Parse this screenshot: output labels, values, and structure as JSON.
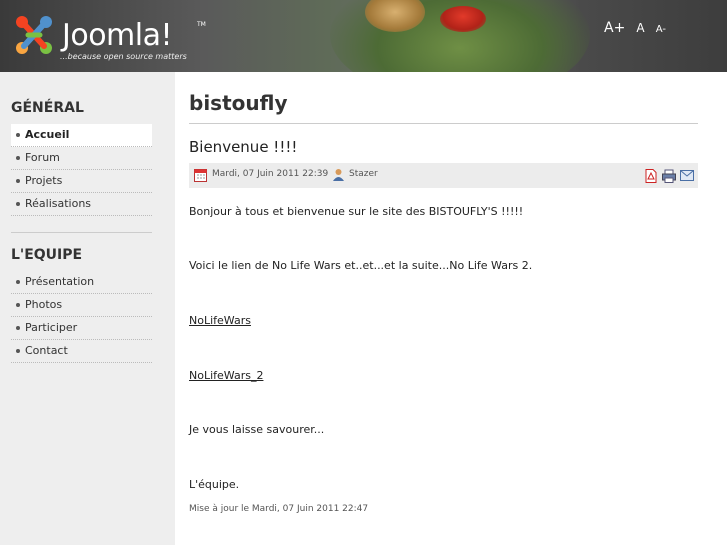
{
  "header": {
    "logo_text": "Joomla!",
    "logo_tm": "TM",
    "tagline": "...because open source matters",
    "font_size_controls": {
      "bigger": "A+",
      "reset": "A",
      "smaller": "A-"
    }
  },
  "sidebar": {
    "modules": [
      {
        "title": "GÉNÉRAL",
        "items": [
          {
            "label": "Accueil",
            "active": true
          },
          {
            "label": "Forum"
          },
          {
            "label": "Projets"
          },
          {
            "label": "Réalisations"
          }
        ]
      },
      {
        "title": "L'EQUIPE",
        "items": [
          {
            "label": "Présentation"
          },
          {
            "label": "Photos"
          },
          {
            "label": "Participer"
          },
          {
            "label": "Contact"
          }
        ]
      }
    ]
  },
  "main": {
    "site_title": "bistoufly",
    "article": {
      "title": "Bienvenue !!!!",
      "date": "Mardi, 07 Juin 2011 22:39",
      "author": "Stazer",
      "paragraphs": [
        "Bonjour à tous et bienvenue sur le site des BISTOUFLY'S !!!!!",
        "Voici le lien de No Life Wars et..et...et la suite...No Life Wars 2.",
        "Je vous laisse savourer...",
        "L'équipe."
      ],
      "links": [
        "NoLifeWars",
        "NoLifeWars_2"
      ],
      "modified": "Mise à jour le Mardi, 07 Juin 2011 22:47"
    }
  },
  "colors": {
    "header_bg": "#4a4a4a",
    "sidebar_bg": "#eeeeee",
    "infobar_bg": "#ececec"
  },
  "icons": [
    "calendar-icon",
    "user-icon",
    "pdf-icon",
    "print-icon",
    "email-icon"
  ]
}
